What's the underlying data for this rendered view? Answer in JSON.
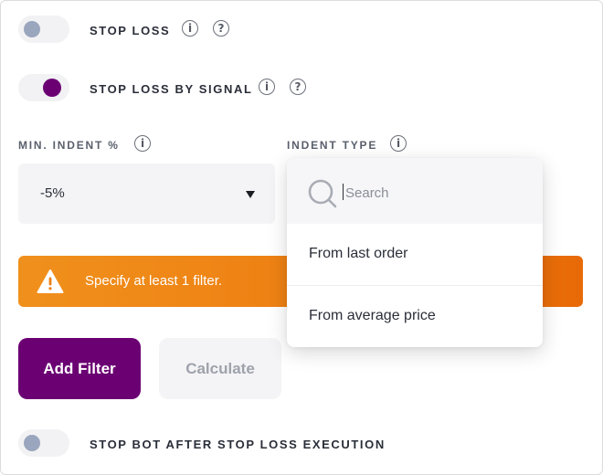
{
  "stop_loss": {
    "label": "STOP LOSS",
    "enabled": false
  },
  "stop_loss_by_signal": {
    "label": "STOP LOSS BY SIGNAL",
    "enabled": true
  },
  "min_indent": {
    "label": "MIN. INDENT %",
    "value": "-5%"
  },
  "indent_type": {
    "label": "INDENT TYPE",
    "search_placeholder": "Search",
    "options": [
      "From last order",
      "From average price"
    ]
  },
  "warning": {
    "message": "Specify at least 1 filter."
  },
  "actions": {
    "add_filter": "Add Filter",
    "calculate": "Calculate"
  },
  "stop_bot": {
    "label": "STOP BOT AFTER STOP LOSS EXECUTION",
    "enabled": false
  },
  "icons": {
    "info": "i",
    "help": "?"
  },
  "colors": {
    "accent": "#6b0073",
    "warning": "#ee7f12"
  }
}
